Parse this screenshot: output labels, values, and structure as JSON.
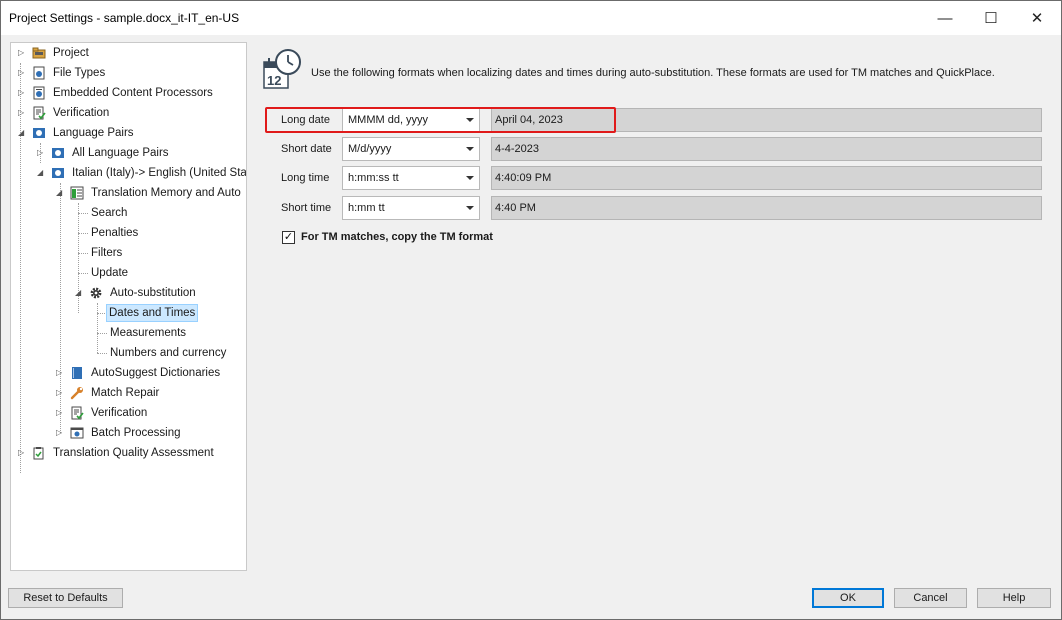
{
  "window": {
    "title": "Project Settings - sample.docx_it-IT_en-US"
  },
  "window_controls": {
    "minimize": "—",
    "maximize": "☐",
    "close": "✕"
  },
  "tree": {
    "items": [
      {
        "label": "Project",
        "icon": "folder-icon"
      },
      {
        "label": "File Types",
        "icon": "file-types-icon"
      },
      {
        "label": "Embedded Content Processors",
        "icon": "processor-icon"
      },
      {
        "label": "Verification",
        "icon": "verification-icon"
      },
      {
        "label": "Language Pairs",
        "icon": "language-pairs-icon"
      },
      {
        "label": "All Language Pairs",
        "icon": "language-pairs-icon"
      },
      {
        "label": "Italian (Italy)-> English (United Stat",
        "icon": "language-pair-icon"
      },
      {
        "label": "Translation Memory and Auto",
        "icon": "translation-memory-icon"
      },
      {
        "label": "Search"
      },
      {
        "label": "Penalties"
      },
      {
        "label": "Filters"
      },
      {
        "label": "Update"
      },
      {
        "label": "Auto-substitution",
        "icon": "gear-icon"
      },
      {
        "label": "Dates and Times",
        "selected": true
      },
      {
        "label": "Measurements"
      },
      {
        "label": "Numbers and currency"
      },
      {
        "label": "AutoSuggest Dictionaries",
        "icon": "dictionary-icon"
      },
      {
        "label": "Match Repair",
        "icon": "wrench-icon"
      },
      {
        "label": "Verification",
        "icon": "verification-icon"
      },
      {
        "label": "Batch Processing",
        "icon": "batch-icon"
      },
      {
        "label": "Translation Quality Assessment",
        "icon": "clipboard-icon"
      }
    ]
  },
  "main": {
    "icon": "calendar-clock-icon",
    "description": "Use the following formats when localizing dates and times during auto-substitution. These formats are used for TM matches and QuickPlace.",
    "rows": [
      {
        "label": "Long date",
        "format": "MMMM dd, yyyy",
        "preview": "April 04, 2023",
        "highlighted": true
      },
      {
        "label": "Short date",
        "format": "M/d/yyyy",
        "preview": "4-4-2023"
      },
      {
        "label": "Long time",
        "format": "h:mm:ss tt",
        "preview": "4:40:09 PM"
      },
      {
        "label": "Short time",
        "format": "h:mm tt",
        "preview": "4:40 PM"
      }
    ],
    "checkbox": {
      "label": "For TM matches, copy the TM format",
      "checked": true,
      "mark": "✓"
    }
  },
  "footer": {
    "reset_label": "Reset to Defaults",
    "ok_label": "OK",
    "cancel_label": "Cancel",
    "help_label": "Help"
  },
  "colors": {
    "highlight": "#e01a1a",
    "selection": "#cce8ff",
    "default_button_border": "#0078d7"
  }
}
